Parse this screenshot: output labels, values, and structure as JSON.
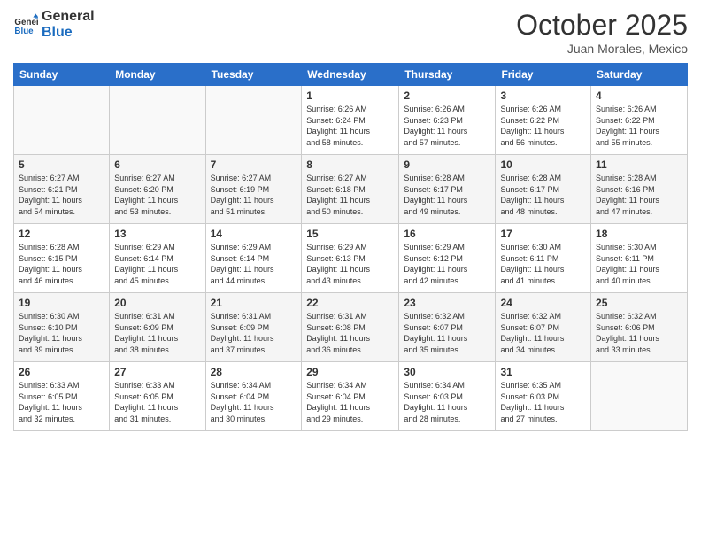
{
  "header": {
    "logo_line1": "General",
    "logo_line2": "Blue",
    "month": "October 2025",
    "location": "Juan Morales, Mexico"
  },
  "days_of_week": [
    "Sunday",
    "Monday",
    "Tuesday",
    "Wednesday",
    "Thursday",
    "Friday",
    "Saturday"
  ],
  "weeks": [
    [
      {
        "day": "",
        "empty": true
      },
      {
        "day": "",
        "empty": true
      },
      {
        "day": "",
        "empty": true
      },
      {
        "day": "1",
        "sunrise": "6:26 AM",
        "sunset": "6:24 PM",
        "daylight": "11 hours and 58 minutes."
      },
      {
        "day": "2",
        "sunrise": "6:26 AM",
        "sunset": "6:23 PM",
        "daylight": "11 hours and 57 minutes."
      },
      {
        "day": "3",
        "sunrise": "6:26 AM",
        "sunset": "6:22 PM",
        "daylight": "11 hours and 56 minutes."
      },
      {
        "day": "4",
        "sunrise": "6:26 AM",
        "sunset": "6:22 PM",
        "daylight": "11 hours and 55 minutes."
      }
    ],
    [
      {
        "day": "5",
        "sunrise": "6:27 AM",
        "sunset": "6:21 PM",
        "daylight": "11 hours and 54 minutes."
      },
      {
        "day": "6",
        "sunrise": "6:27 AM",
        "sunset": "6:20 PM",
        "daylight": "11 hours and 53 minutes."
      },
      {
        "day": "7",
        "sunrise": "6:27 AM",
        "sunset": "6:19 PM",
        "daylight": "11 hours and 51 minutes."
      },
      {
        "day": "8",
        "sunrise": "6:27 AM",
        "sunset": "6:18 PM",
        "daylight": "11 hours and 50 minutes."
      },
      {
        "day": "9",
        "sunrise": "6:28 AM",
        "sunset": "6:17 PM",
        "daylight": "11 hours and 49 minutes."
      },
      {
        "day": "10",
        "sunrise": "6:28 AM",
        "sunset": "6:17 PM",
        "daylight": "11 hours and 48 minutes."
      },
      {
        "day": "11",
        "sunrise": "6:28 AM",
        "sunset": "6:16 PM",
        "daylight": "11 hours and 47 minutes."
      }
    ],
    [
      {
        "day": "12",
        "sunrise": "6:28 AM",
        "sunset": "6:15 PM",
        "daylight": "11 hours and 46 minutes."
      },
      {
        "day": "13",
        "sunrise": "6:29 AM",
        "sunset": "6:14 PM",
        "daylight": "11 hours and 45 minutes."
      },
      {
        "day": "14",
        "sunrise": "6:29 AM",
        "sunset": "6:14 PM",
        "daylight": "11 hours and 44 minutes."
      },
      {
        "day": "15",
        "sunrise": "6:29 AM",
        "sunset": "6:13 PM",
        "daylight": "11 hours and 43 minutes."
      },
      {
        "day": "16",
        "sunrise": "6:29 AM",
        "sunset": "6:12 PM",
        "daylight": "11 hours and 42 minutes."
      },
      {
        "day": "17",
        "sunrise": "6:30 AM",
        "sunset": "6:11 PM",
        "daylight": "11 hours and 41 minutes."
      },
      {
        "day": "18",
        "sunrise": "6:30 AM",
        "sunset": "6:11 PM",
        "daylight": "11 hours and 40 minutes."
      }
    ],
    [
      {
        "day": "19",
        "sunrise": "6:30 AM",
        "sunset": "6:10 PM",
        "daylight": "11 hours and 39 minutes."
      },
      {
        "day": "20",
        "sunrise": "6:31 AM",
        "sunset": "6:09 PM",
        "daylight": "11 hours and 38 minutes."
      },
      {
        "day": "21",
        "sunrise": "6:31 AM",
        "sunset": "6:09 PM",
        "daylight": "11 hours and 37 minutes."
      },
      {
        "day": "22",
        "sunrise": "6:31 AM",
        "sunset": "6:08 PM",
        "daylight": "11 hours and 36 minutes."
      },
      {
        "day": "23",
        "sunrise": "6:32 AM",
        "sunset": "6:07 PM",
        "daylight": "11 hours and 35 minutes."
      },
      {
        "day": "24",
        "sunrise": "6:32 AM",
        "sunset": "6:07 PM",
        "daylight": "11 hours and 34 minutes."
      },
      {
        "day": "25",
        "sunrise": "6:32 AM",
        "sunset": "6:06 PM",
        "daylight": "11 hours and 33 minutes."
      }
    ],
    [
      {
        "day": "26",
        "sunrise": "6:33 AM",
        "sunset": "6:05 PM",
        "daylight": "11 hours and 32 minutes."
      },
      {
        "day": "27",
        "sunrise": "6:33 AM",
        "sunset": "6:05 PM",
        "daylight": "11 hours and 31 minutes."
      },
      {
        "day": "28",
        "sunrise": "6:34 AM",
        "sunset": "6:04 PM",
        "daylight": "11 hours and 30 minutes."
      },
      {
        "day": "29",
        "sunrise": "6:34 AM",
        "sunset": "6:04 PM",
        "daylight": "11 hours and 29 minutes."
      },
      {
        "day": "30",
        "sunrise": "6:34 AM",
        "sunset": "6:03 PM",
        "daylight": "11 hours and 28 minutes."
      },
      {
        "day": "31",
        "sunrise": "6:35 AM",
        "sunset": "6:03 PM",
        "daylight": "11 hours and 27 minutes."
      },
      {
        "day": "",
        "empty": true
      }
    ]
  ],
  "labels": {
    "sunrise": "Sunrise:",
    "sunset": "Sunset:",
    "daylight": "Daylight:"
  }
}
